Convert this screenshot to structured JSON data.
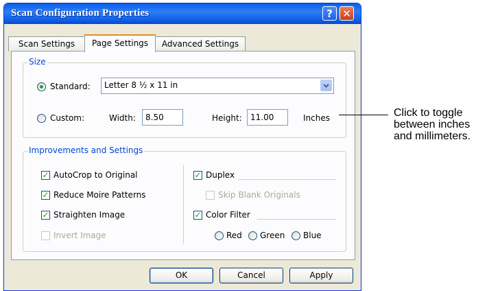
{
  "window": {
    "title": "Scan Configuration Properties",
    "help_label": "?",
    "close_label": "✕"
  },
  "tabs": [
    {
      "label": "Scan Settings",
      "active": false
    },
    {
      "label": "Page Settings",
      "active": true
    },
    {
      "label": "Advanced Settings",
      "active": false
    }
  ],
  "size": {
    "legend": "Size",
    "standard_label": "Standard:",
    "standard_selected": true,
    "standard_value": "Letter 8 ½ x 11 in",
    "custom_label": "Custom:",
    "custom_selected": false,
    "width_label": "Width:",
    "width_value": "8.50",
    "height_label": "Height:",
    "height_value": "11.00",
    "units_label": "Inches"
  },
  "improvements": {
    "legend": "Improvements and Settings",
    "autocrop": {
      "label": "AutoCrop to Original",
      "checked": true,
      "enabled": true
    },
    "moire": {
      "label": "Reduce Moire Patterns",
      "checked": true,
      "enabled": true
    },
    "straighten": {
      "label": "Straighten Image",
      "checked": true,
      "enabled": true
    },
    "invert": {
      "label": "Invert Image",
      "checked": false,
      "enabled": false
    },
    "duplex": {
      "label": "Duplex",
      "checked": true,
      "enabled": true
    },
    "skip_blank": {
      "label": "Skip Blank Originals",
      "checked": false,
      "enabled": false
    },
    "color_filter": {
      "label": "Color Filter",
      "checked": true,
      "enabled": true
    },
    "red_label": "Red",
    "green_label": "Green",
    "blue_label": "Blue"
  },
  "buttons": {
    "ok": "OK",
    "cancel": "Cancel",
    "apply": "Apply"
  },
  "callout": {
    "line1": "Click to toggle",
    "line2": "between inches",
    "line3": "and millimeters."
  },
  "colors": {
    "titlebar": "#0a5fe8",
    "group_legend": "#0046d5",
    "check_mark": "#21a121",
    "dialog_bg": "#ece9d8"
  },
  "icons": {
    "check": "checkmark",
    "combo": "chevron-down-icon"
  }
}
